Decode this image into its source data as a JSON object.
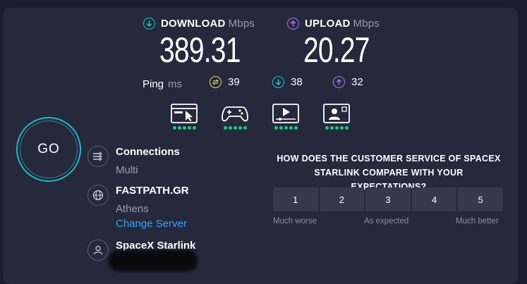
{
  "download": {
    "label": "DOWNLOAD",
    "unit": "Mbps",
    "value": "389.31",
    "color": "#1cc3c8"
  },
  "upload": {
    "label": "UPLOAD",
    "unit": "Mbps",
    "value": "20.27",
    "color": "#a675e8"
  },
  "ping": {
    "label": "Ping",
    "unit": "ms",
    "idle": {
      "value": "39",
      "color": "#e8d95a"
    },
    "download": {
      "value": "38",
      "color": "#1cc3c8"
    },
    "upload": {
      "value": "32",
      "color": "#a675e8"
    }
  },
  "go_button": {
    "label": "GO"
  },
  "connections": {
    "title": "Connections",
    "mode": "Multi"
  },
  "server": {
    "name": "FASTPATH.GR",
    "location": "Athens",
    "change_label": "Change Server"
  },
  "provider": {
    "name": "SpaceX Starlink"
  },
  "survey": {
    "question": "HOW DOES THE CUSTOMER SERVICE OF SPACEX STARLINK COMPARE WITH YOUR EXPECTATIONS?",
    "options": [
      "1",
      "2",
      "3",
      "4",
      "5"
    ],
    "scale_low": "Much worse",
    "scale_mid": "As expected",
    "scale_high": "Much better"
  },
  "colors": {
    "accent_go": "#1eb8c4",
    "link": "#2ca6ff",
    "rating_dot": "#1fc97a"
  }
}
